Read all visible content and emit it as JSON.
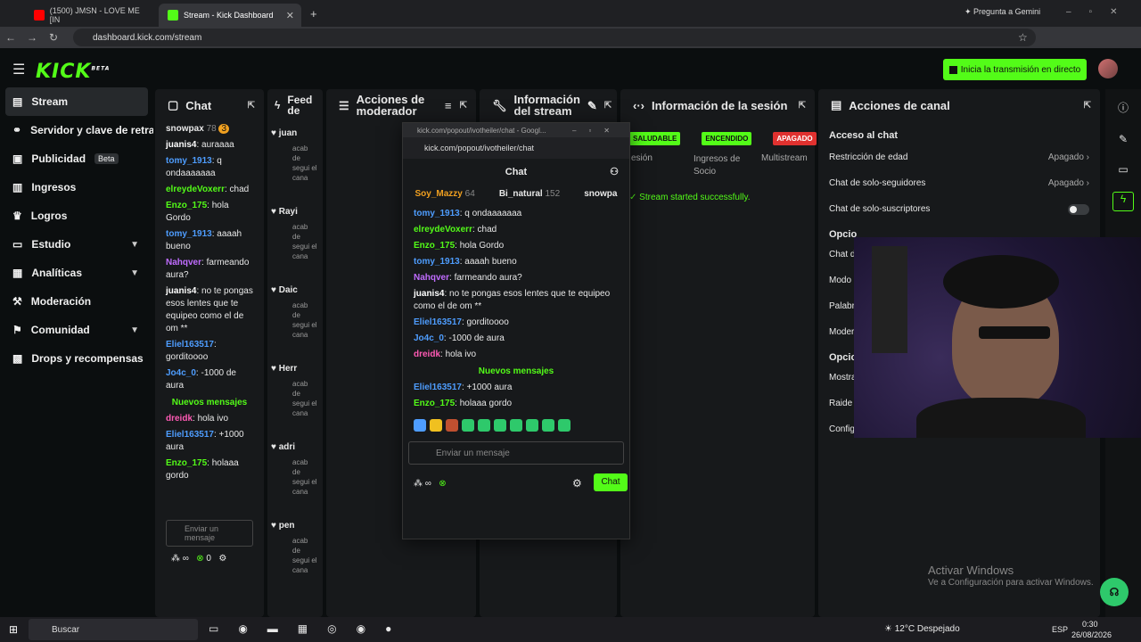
{
  "browser": {
    "tabs": [
      {
        "label": "(1500) JMSN - LOVE ME [IN"
      },
      {
        "label": "Stream - Kick Dashboard"
      }
    ],
    "url": "dashboard.kick.com/stream",
    "gemini": "Pregunta a Gemini"
  },
  "header": {
    "logo": "KICK",
    "logo_sup": "BETA",
    "go_live": "Inicia la transmisión en directo"
  },
  "sidebar": {
    "items": [
      {
        "label": "Stream"
      },
      {
        "label": "Servidor y clave de retransmisión"
      },
      {
        "label": "Publicidad",
        "badge": "Beta"
      },
      {
        "label": "Ingresos"
      },
      {
        "label": "Logros"
      },
      {
        "label": "Estudio"
      },
      {
        "label": "Analíticas"
      },
      {
        "label": "Moderación"
      },
      {
        "label": "Comunidad"
      },
      {
        "label": "Drops y recompensas"
      }
    ]
  },
  "chat": {
    "title": "Chat",
    "top": {
      "user": "snowpax",
      "count": "78",
      "badge": "3"
    },
    "messages": [
      {
        "user": "juanis4",
        "text": "auraaaa",
        "color": "#ffffff"
      },
      {
        "user": "tomy_1913",
        "text": "q ondaaaaaaa",
        "color": "#4e9dff"
      },
      {
        "user": "elreydeVoxerr",
        "text": "chad",
        "color": "#53fc18"
      },
      {
        "user": "Enzo_175",
        "text": "hola Gordo",
        "color": "#53fc18"
      },
      {
        "user": "tomy_1913",
        "text": "aaaah bueno",
        "color": "#4e9dff"
      },
      {
        "user": "Nahqver",
        "text": "farmeando aura?",
        "color": "#c06cff"
      },
      {
        "user": "juanis4",
        "text": "no te pongas esos lentes que te equipeo como el de om **",
        "color": "#ffffff"
      },
      {
        "user": "Eliel163517",
        "text": "gorditoooo",
        "color": "#4e9dff"
      },
      {
        "user": "Jo4c_0",
        "text": "-1000 de aura",
        "color": "#4e9dff"
      }
    ],
    "new_label": "Nuevos mensajes",
    "after": [
      {
        "user": "dreidk",
        "text": "hola ivo",
        "color": "#ff5ab4"
      },
      {
        "user": "Eliel163517",
        "text": "+1000 aura",
        "color": "#4e9dff"
      },
      {
        "user": "Enzo_175",
        "text": "holaaa gordo",
        "color": "#53fc18"
      }
    ],
    "placeholder": "Enviar un mensaje",
    "points": "0"
  },
  "feed": {
    "title": "Feed de actividad",
    "items": [
      {
        "user": "juan"
      },
      {
        "user": "Rayi"
      },
      {
        "user": "Daic"
      },
      {
        "user": "Herr"
      },
      {
        "user": "adri"
      },
      {
        "user": "pen"
      }
    ],
    "sub": "acab de segui el cana"
  },
  "modactions": {
    "title": "Acciones de moderador"
  },
  "streaminfo": {
    "title": "Información del stream"
  },
  "session": {
    "title": "Información de la sesión",
    "badges": [
      {
        "label": "SALUDABLE",
        "bg": "#53fc18",
        "fg": "#111"
      },
      {
        "label": "ENCENDIDO",
        "bg": "#53fc18",
        "fg": "#111"
      },
      {
        "label": "APAGADO",
        "bg": "#e0312f",
        "fg": "#fff"
      }
    ],
    "labels": [
      "esión",
      "Ingresos de Socio",
      "Multistream"
    ],
    "status": "Stream started successfully."
  },
  "channel": {
    "title": "Acciones de canal",
    "access": "Acceso al chat",
    "rows": [
      {
        "label": "Restricción de edad",
        "value": "Apagado"
      },
      {
        "label": "Chat de solo-seguidores",
        "value": "Apagado"
      },
      {
        "label": "Chat de solo-suscriptores",
        "value": ""
      }
    ],
    "opc1": "Opcio",
    "sub1": [
      "Chat d",
      "Modo",
      "Palabr",
      "Moder"
    ],
    "opc2": "Opcio",
    "sub2": [
      "Mostra",
      "Raide"
    ],
    "goals": "Configurar objetivos"
  },
  "popup": {
    "titlebar": "kick.com/popout/ivotheiler/chat - Googl...",
    "url": "kick.com/popout/ivotheiler/chat",
    "chat_title": "Chat",
    "top": [
      {
        "user": "Soy_Mazzy",
        "count": "64"
      },
      {
        "user": "Bi_natural",
        "count": "152"
      },
      {
        "user": "snowpa",
        "count": ""
      }
    ],
    "messages": [
      {
        "user": "tomy_1913",
        "text": "q ondaaaaaaa",
        "color": "#4e9dff"
      },
      {
        "user": "elreydeVoxerr",
        "text": "chad",
        "color": "#53fc18"
      },
      {
        "user": "Enzo_175",
        "text": "hola Gordo",
        "color": "#53fc18"
      },
      {
        "user": "tomy_1913",
        "text": "aaaah bueno",
        "color": "#4e9dff"
      },
      {
        "user": "Nahqver",
        "text": "farmeando aura?",
        "color": "#c06cff"
      },
      {
        "user": "juanis4",
        "text": "no te pongas esos lentes que te equipeo como el de om **",
        "color": "#ffffff"
      },
      {
        "user": "Eliel163517",
        "text": "gorditoooo",
        "color": "#4e9dff"
      },
      {
        "user": "Jo4c_0",
        "text": "-1000 de aura",
        "color": "#4e9dff"
      },
      {
        "user": "dreidk",
        "text": "hola ivo",
        "color": "#ff5ab4"
      }
    ],
    "new_label": "Nuevos mensajes",
    "after": [
      {
        "user": "Eliel163517",
        "text": "+1000 aura",
        "color": "#4e9dff"
      },
      {
        "user": "Enzo_175",
        "text": "holaaa gordo",
        "color": "#53fc18"
      }
    ],
    "placeholder": "Enviar un mensaje",
    "send": "Chat"
  },
  "watermark": {
    "line1": "Activar Windows",
    "line2": "Ve a Configuración para activar Windows."
  },
  "taskbar": {
    "search": "Buscar",
    "weather": "12°C Despejado",
    "lang": "ESP",
    "time": "0:30",
    "date": "26/08/2026"
  }
}
